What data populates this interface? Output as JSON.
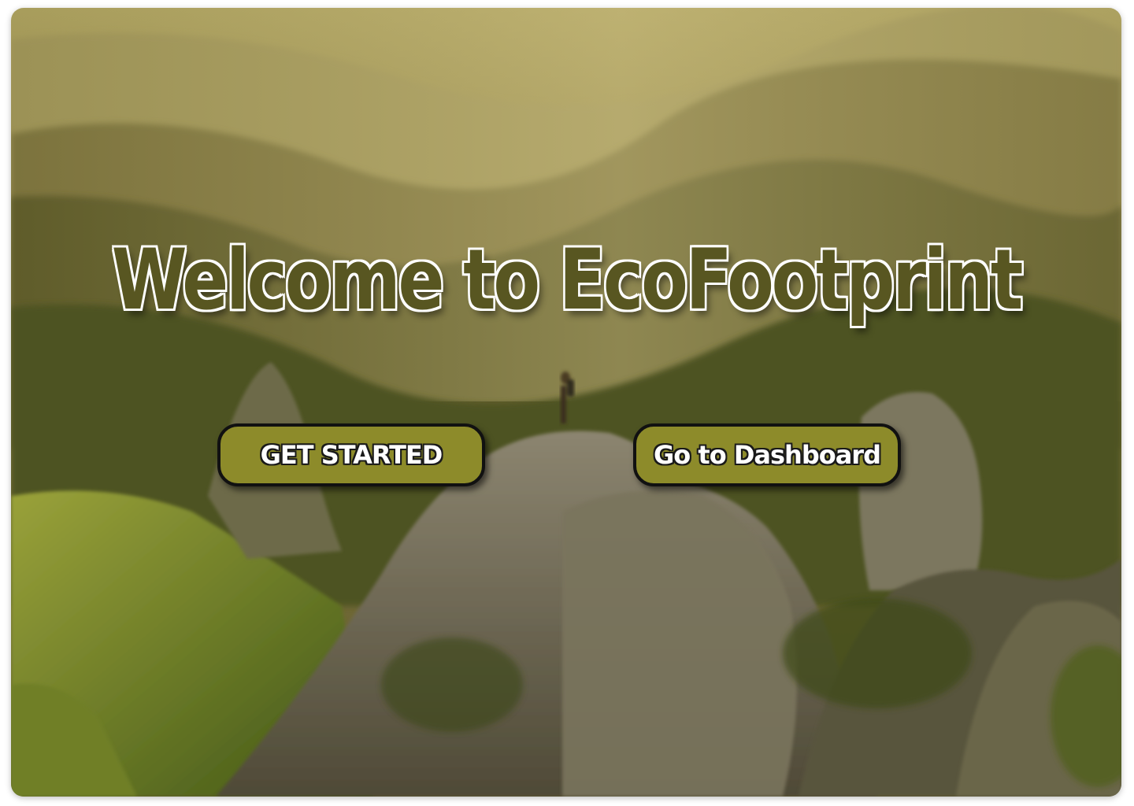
{
  "hero": {
    "title": "Welcome to EcoFootprint",
    "background": "mountain-landscape-with-hiker"
  },
  "actions": {
    "get_started_label": "GET STARTED",
    "dashboard_label": "Go to Dashboard"
  },
  "colors": {
    "title_text": "#585621",
    "button_fill": "#8d8b2a",
    "button_border": "#111111",
    "button_text": "#ffffff"
  }
}
